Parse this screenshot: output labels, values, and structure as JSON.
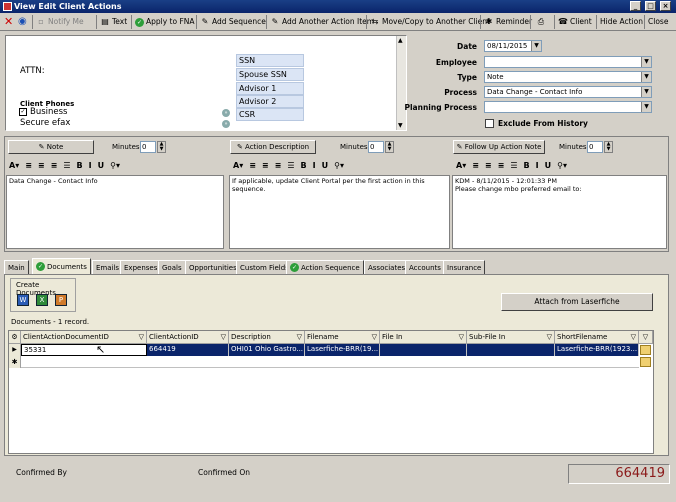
{
  "window": {
    "title": "View Edit Client Actions"
  },
  "toolbar": {
    "notify_me": "Notify Me",
    "text": "Text",
    "apply_to_fna": "Apply to FNA",
    "add_sequence": "Add Sequence",
    "add_another_action_item": "Add Another Action Item",
    "move_copy": "Move/Copy to Another Client",
    "reminder": "Reminder",
    "client": "Client",
    "hide_action": "Hide Action",
    "close": "Close"
  },
  "client_info": {
    "attn_label": "ATTN:",
    "phones_label": "Client Phones",
    "phone_business": "Business",
    "phone_secure_efax": "Secure efax",
    "contacts": [
      "SSN",
      "Spouse SSN",
      "Advisor 1",
      "Advisor 2",
      "CSR"
    ]
  },
  "action_fields": {
    "date_label": "Date",
    "date_value": "08/11/2015",
    "employee_label": "Employee",
    "employee_value": "",
    "type_label": "Type",
    "type_value": "Note",
    "process_label": "Process",
    "process_value": "Data Change - Contact Info",
    "planning_process_label": "Planning Process",
    "planning_process_value": "",
    "exclude_label": "Exclude From History"
  },
  "notes": {
    "minutes_label": "Minutes",
    "note": {
      "button": "Note",
      "minutes": "0",
      "text": "Data Change - Contact Info"
    },
    "description": {
      "button": "Action Description",
      "minutes": "0",
      "text": "If applicable, update Client Portal per the first action in this\nsequence."
    },
    "followup": {
      "button": "Follow Up Action Note",
      "minutes": "0",
      "text": "KDM - 8/11/2015 - 12:01:33 PM\nPlease change mbo preferred email to:"
    }
  },
  "tabs": [
    "Main",
    "Documents",
    "Emails",
    "Expenses",
    "Goals",
    "Opportunities",
    "Custom Fields",
    "Action Sequence",
    "Associates",
    "Accounts",
    "Insurance"
  ],
  "documents": {
    "create_label": "Create Documents",
    "attach_button": "Attach from Laserfiche",
    "record_count": "Documents - 1 record.",
    "columns": [
      "ClientActionDocumentID",
      "ClientActionID",
      "Description",
      "Filename",
      "File In",
      "Sub-File In",
      "ShortFilename"
    ],
    "rows": [
      [
        "35331",
        "664419",
        "OHI01 Ohio Gastro...",
        "Laserfiche-BRR(19...",
        "",
        "",
        "Laserfiche-BRR(1923..."
      ]
    ]
  },
  "footer": {
    "confirmed_by_label": "Confirmed By",
    "confirmed_on_label": "Confirmed On",
    "action_id": "664419"
  },
  "colors": {
    "title_bar": "#0a246a",
    "selected_row": "#0a246a",
    "action_id_text": "#8b1a1a"
  }
}
